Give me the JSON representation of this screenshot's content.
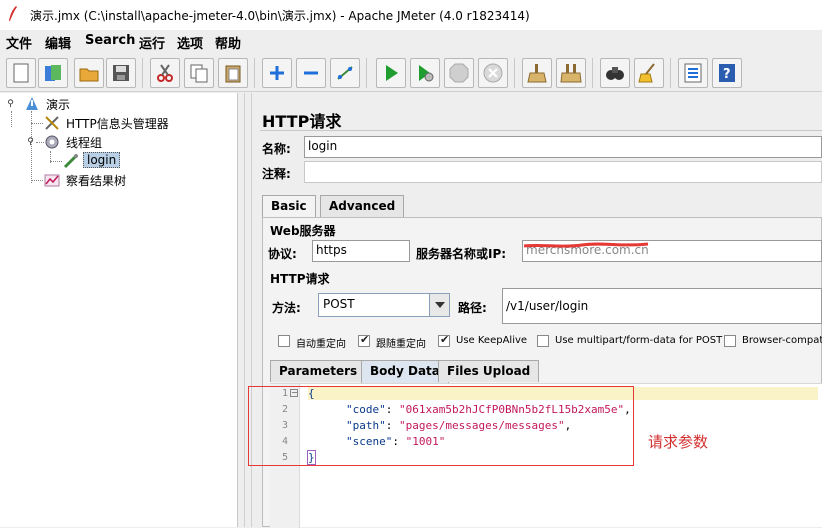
{
  "window": {
    "title": "演示.jmx (C:\\install\\apache-jmeter-4.0\\bin\\演示.jmx) - Apache JMeter (4.0 r1823414)"
  },
  "menu": [
    "文件",
    "编辑",
    "Search",
    "运行",
    "选项",
    "帮助"
  ],
  "toolbar": [
    {
      "name": "new-icon"
    },
    {
      "name": "templates-icon"
    },
    {
      "name": "open-icon"
    },
    {
      "name": "save-icon"
    },
    {
      "name": "cut-icon"
    },
    {
      "name": "copy-icon"
    },
    {
      "name": "paste-icon"
    },
    {
      "name": "expand-icon"
    },
    {
      "name": "collapse-icon"
    },
    {
      "name": "toggle-icon"
    },
    {
      "name": "start-icon"
    },
    {
      "name": "start-no-pause-icon"
    },
    {
      "name": "stop-icon"
    },
    {
      "name": "shutdown-icon"
    },
    {
      "name": "clear-icon"
    },
    {
      "name": "clear-all-icon"
    },
    {
      "name": "search-icon"
    },
    {
      "name": "reset-search-icon"
    },
    {
      "name": "function-helper-icon"
    },
    {
      "name": "help-icon"
    }
  ],
  "tree": {
    "items": [
      {
        "label": "演示",
        "icon": "testplan-icon"
      },
      {
        "label": "HTTP信息头管理器",
        "icon": "tools-icon"
      },
      {
        "label": "线程组",
        "icon": "gear-icon"
      },
      {
        "label": "login",
        "icon": "sampler-icon"
      },
      {
        "label": "察看结果树",
        "icon": "chart-icon"
      }
    ]
  },
  "pane": {
    "title": "HTTP请求",
    "name_label": "名称:",
    "name_value": "login",
    "comment_label": "注释:",
    "comment_value": "",
    "tabs": [
      "Basic",
      "Advanced"
    ],
    "web_server": {
      "title": "Web服务器",
      "protocol_label": "协议:",
      "protocol_value": "https",
      "server_label": "服务器名称或IP:",
      "server_value": "merchsmore.com.cn"
    },
    "http_request": {
      "title": "HTTP请求",
      "method_label": "方法:",
      "method_value": "POST",
      "path_label": "路径:",
      "path_value": "/v1/user/login"
    },
    "checkboxes": [
      {
        "label": "自动重定向",
        "checked": false
      },
      {
        "label": "跟随重定向",
        "checked": true
      },
      {
        "label": "Use KeepAlive",
        "checked": true
      },
      {
        "label": "Use multipart/form-data for POST",
        "checked": false
      },
      {
        "label": "Browser-compatib",
        "checked": false
      }
    ],
    "body_tabs": [
      "Parameters",
      "Body Data",
      "Files Upload"
    ],
    "body": {
      "line_numbers": [
        "1",
        "2",
        "3",
        "4",
        "5"
      ],
      "lines": [
        {
          "text": "{"
        },
        {
          "key": "\"code\"",
          "value": "\"061xam5b2hJCfP0BNn5b2fL15b2xam5e\"",
          "end": ","
        },
        {
          "key": "\"path\"",
          "value": "\"pages/messages/messages\"",
          "end": ","
        },
        {
          "key": "\"scene\"",
          "value": "\"1001\"",
          "end": ""
        },
        {
          "text": "}"
        }
      ]
    },
    "annotation": "请求参数"
  },
  "colors": {
    "annotation": "#d32f2f",
    "json_key": "#0a3a8a",
    "json_string": "#c2185b",
    "selection": "#b8cfe5"
  }
}
